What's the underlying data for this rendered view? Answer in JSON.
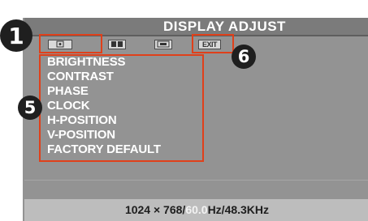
{
  "title": "DISPLAY ADJUST",
  "tabs": [
    {
      "label": "",
      "icon": "display-adjust-icon",
      "selected": true
    },
    {
      "label": "",
      "icon": "color-adjust-icon",
      "selected": false
    },
    {
      "label": "",
      "icon": "settings-icon",
      "selected": false
    },
    {
      "label": "EXIT",
      "icon": "exit-icon",
      "selected": false
    }
  ],
  "menu": {
    "items": [
      {
        "label": "BRIGHTNESS"
      },
      {
        "label": "CONTRAST"
      },
      {
        "label": "PHASE"
      },
      {
        "label": "CLOCK"
      },
      {
        "label": "H-POSITION"
      },
      {
        "label": "V-POSITION"
      },
      {
        "label": "FACTORY DEFAULT"
      }
    ]
  },
  "status": {
    "resolution": "1024 × 768/",
    "refresh_value": "60.0",
    "frequency_suffix": "Hz/48.3KHz"
  },
  "callouts": {
    "main": "1",
    "menu": "5",
    "exit": "6"
  },
  "colors": {
    "highlight": "#e0401a",
    "osd_background": "#939393",
    "title_bar": "#7b7b7b"
  }
}
